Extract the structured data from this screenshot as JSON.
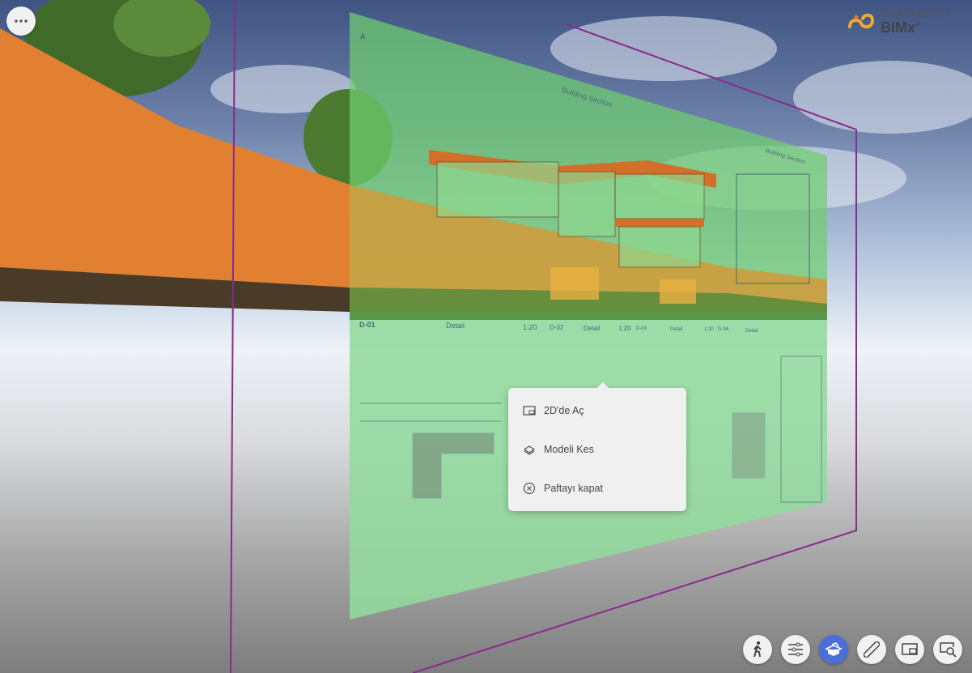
{
  "app": {
    "brand_line1": "GRAPHISOFT",
    "brand_line2": "BIMx",
    "brand_mark": "®"
  },
  "more_button": {
    "icon": "ellipsis-icon"
  },
  "sheet": {
    "labels": {
      "section_a": "A",
      "section_title": "Building Section",
      "section_b_title": "Building Section",
      "d01": "D-01",
      "d01_title": "Detail",
      "d01_scale": "1:20",
      "d02": "D-02",
      "d02_title": "Detail",
      "d02_scale": "1:20",
      "d03": "D-03",
      "d03_title": "Detail",
      "d03_scale": "1:20",
      "d04": "D-04",
      "d04_title": "Detail"
    }
  },
  "context_menu": {
    "items": [
      {
        "label": "2D'de Aç",
        "icon": "open-2d-icon"
      },
      {
        "label": "Modeli Kes",
        "icon": "cut-model-icon"
      },
      {
        "label": "Paftayı kapat",
        "icon": "close-circle-icon"
      }
    ]
  },
  "toolbar": {
    "buttons": [
      {
        "name": "walk",
        "icon": "walk-icon",
        "active": false
      },
      {
        "name": "settings",
        "icon": "sliders-icon",
        "active": false
      },
      {
        "name": "section-box",
        "icon": "section-box-icon",
        "active": true
      },
      {
        "name": "measure",
        "icon": "ruler-icon",
        "active": false
      },
      {
        "name": "sheets",
        "icon": "sheet-icon",
        "active": false
      },
      {
        "name": "zoom-view",
        "icon": "zoom-screen-icon",
        "active": false
      }
    ]
  },
  "colors": {
    "accent": "#4a6fd8",
    "sheet_overlay": "#6fcf6f",
    "section_plane": "#8a2a8a",
    "wall": "#e08030"
  }
}
